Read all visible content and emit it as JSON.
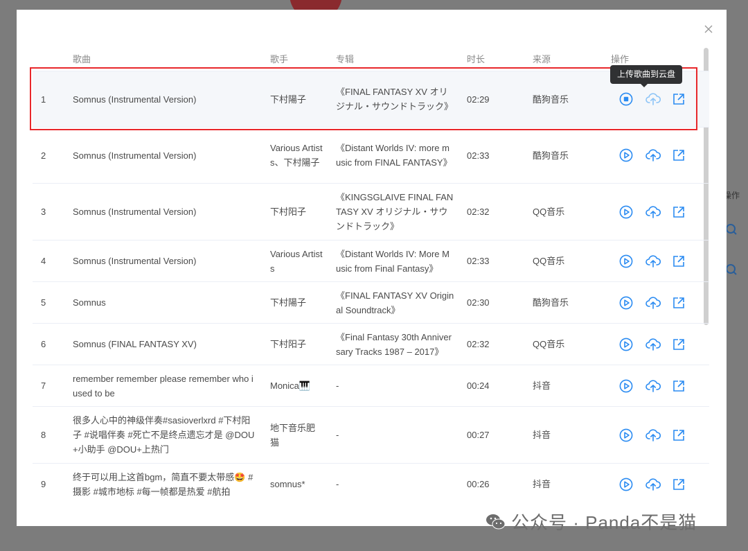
{
  "background": {
    "side_label": "操作"
  },
  "columns": [
    "歌曲",
    "歌手",
    "专辑",
    "时长",
    "来源",
    "操作"
  ],
  "tooltip": "上传歌曲到云盘",
  "watermark": "公众号 · Panda不是猫",
  "colors": {
    "accent": "#2a8bf2",
    "highlight_border": "#e8272b"
  },
  "rows": [
    {
      "index": "1",
      "song": "Somnus (Instrumental Version)",
      "artist": "下村陽子",
      "album": "《FINAL FANTASY XV オリジナル・サウンドトラック》",
      "duration": "02:29",
      "source": "酷狗音乐",
      "playing": true
    },
    {
      "index": "2",
      "song": "Somnus (Instrumental Version)",
      "artist": "Various Artists、下村陽子",
      "album": "《Distant Worlds IV: more music from FINAL FANTASY》",
      "duration": "02:33",
      "source": "酷狗音乐",
      "playing": false
    },
    {
      "index": "3",
      "song": "Somnus (Instrumental Version)",
      "artist": "下村阳子",
      "album": "《KINGSGLAIVE FINAL FANTASY XV オリジナル・サウンドトラック》",
      "duration": "02:32",
      "source": "QQ音乐",
      "playing": false
    },
    {
      "index": "4",
      "song": "Somnus (Instrumental Version)",
      "artist": "Various Artists",
      "album": "《Distant Worlds IV: More Music from Final Fantasy》",
      "duration": "02:33",
      "source": "QQ音乐",
      "playing": false
    },
    {
      "index": "5",
      "song": "Somnus",
      "artist": "下村陽子",
      "album": "《FINAL FANTASY XV Original Soundtrack》",
      "duration": "02:30",
      "source": "酷狗音乐",
      "playing": false
    },
    {
      "index": "6",
      "song": "Somnus (FINAL FANTASY XV)",
      "artist": "下村阳子",
      "album": "《Final Fantasy 30th Anniversary Tracks 1987 – 2017》",
      "duration": "02:32",
      "source": "QQ音乐",
      "playing": false
    },
    {
      "index": "7",
      "song": "remember remember please remember who i used to be",
      "artist": "Monica🎹",
      "album": "-",
      "duration": "00:24",
      "source": "抖音",
      "playing": false
    },
    {
      "index": "8",
      "song": "很多人心中的神级伴奏#sasioverlxrd #下村阳子 #说唱伴奏 #死亡不是终点遗忘才是 @DOU+小助手 @DOU+上热门",
      "artist": "地下音乐肥猫",
      "album": "-",
      "duration": "00:27",
      "source": "抖音",
      "playing": false
    },
    {
      "index": "9",
      "song": "终于可以用上这首bgm，简直不要太带感🤩 #摄影 #城市地标 #每一帧都是热爱 #航拍",
      "artist": "somnus*",
      "album": "-",
      "duration": "00:26",
      "source": "抖音",
      "playing": false
    }
  ]
}
